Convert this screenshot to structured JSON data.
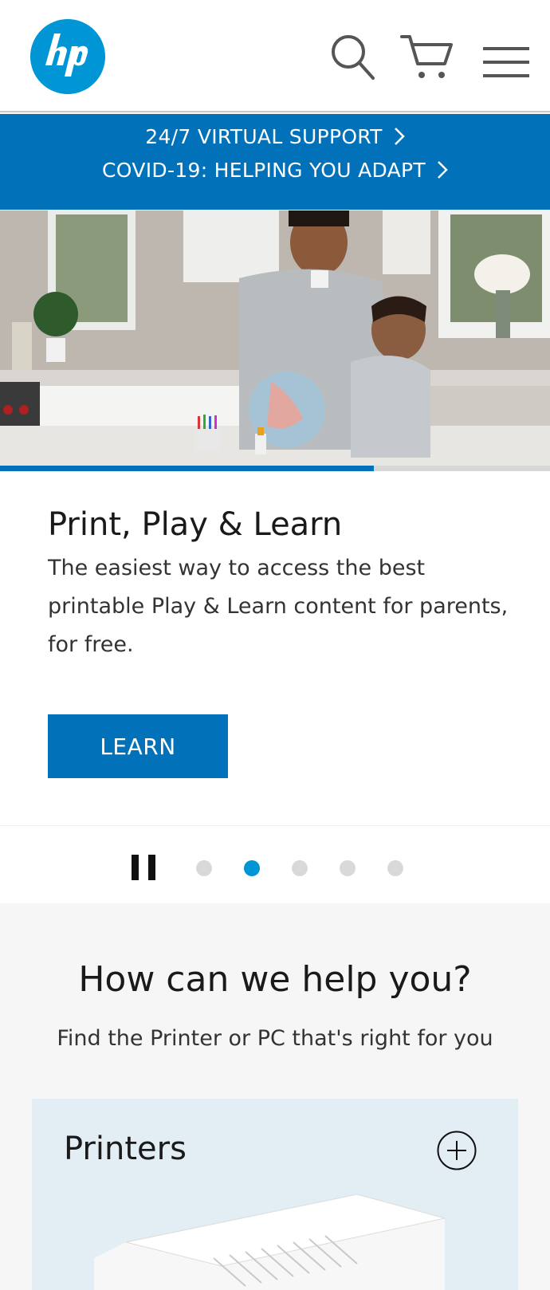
{
  "header": {
    "logo_text": "hp",
    "icons": [
      "search-icon",
      "cart-icon",
      "menu-icon"
    ]
  },
  "banner": {
    "line1": "24/7 VIRTUAL SUPPORT",
    "line2": "COVID-19: HELPING YOU ADAPT"
  },
  "hero": {
    "progress": 0.68
  },
  "slide": {
    "title": "Print, Play & Learn",
    "description": "The easiest way to access the best printable Play & Learn content for parents, for free.",
    "button_label": "LEARN"
  },
  "carousel": {
    "dot_count": 5,
    "active_index": 1
  },
  "help": {
    "title": "How can we help you?",
    "subtitle": "Find the Printer or PC that's right for you",
    "card_title": "Printers"
  },
  "colors": {
    "brand_blue": "#0171b9",
    "logo_blue": "#0096d6"
  }
}
